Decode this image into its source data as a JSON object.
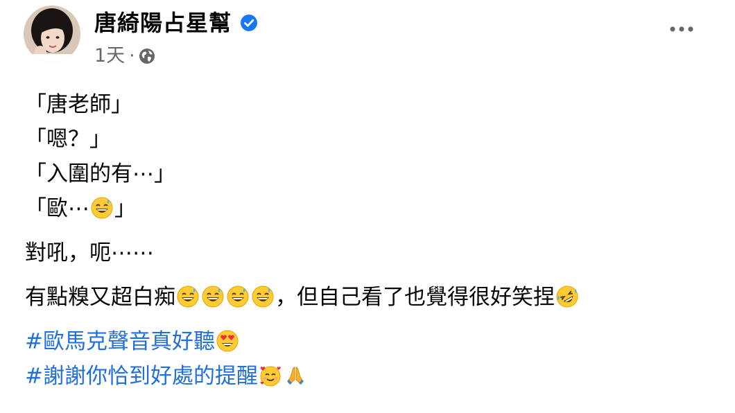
{
  "post": {
    "author": "唐綺陽占星幫",
    "verified": true,
    "timestamp": "1天",
    "meta_separator": "·",
    "audience_icon": "globe-icon",
    "more_icon": "more-horizontal-icon"
  },
  "content": {
    "lines": [
      "「唐老師」",
      "「嗯？」",
      "「入圍的有⋯」",
      "「歐⋯"
    ],
    "line4_end": "」",
    "line5": "對吼，呃⋯⋯",
    "line6_start": "有點糗又超白痴",
    "line6_mid": "，但自己看了也覺得很好笑捏",
    "hashtags": [
      "#歐馬克聲音真好聽",
      "#謝謝你恰到好處的提醒"
    ],
    "emojis": {
      "sweat_smile": "grinning-face-with-sweat-emoji",
      "rofl": "rolling-on-the-floor-laughing-emoji",
      "heart_eyes": "smiling-face-with-heart-eyes-emoji",
      "hearts": "smiling-face-with-hearts-emoji",
      "pray": "folded-hands-emoji"
    }
  },
  "colors": {
    "hashtag": "#216fdb",
    "verified_badge": "#1877f2",
    "secondary_text": "#65676b"
  }
}
